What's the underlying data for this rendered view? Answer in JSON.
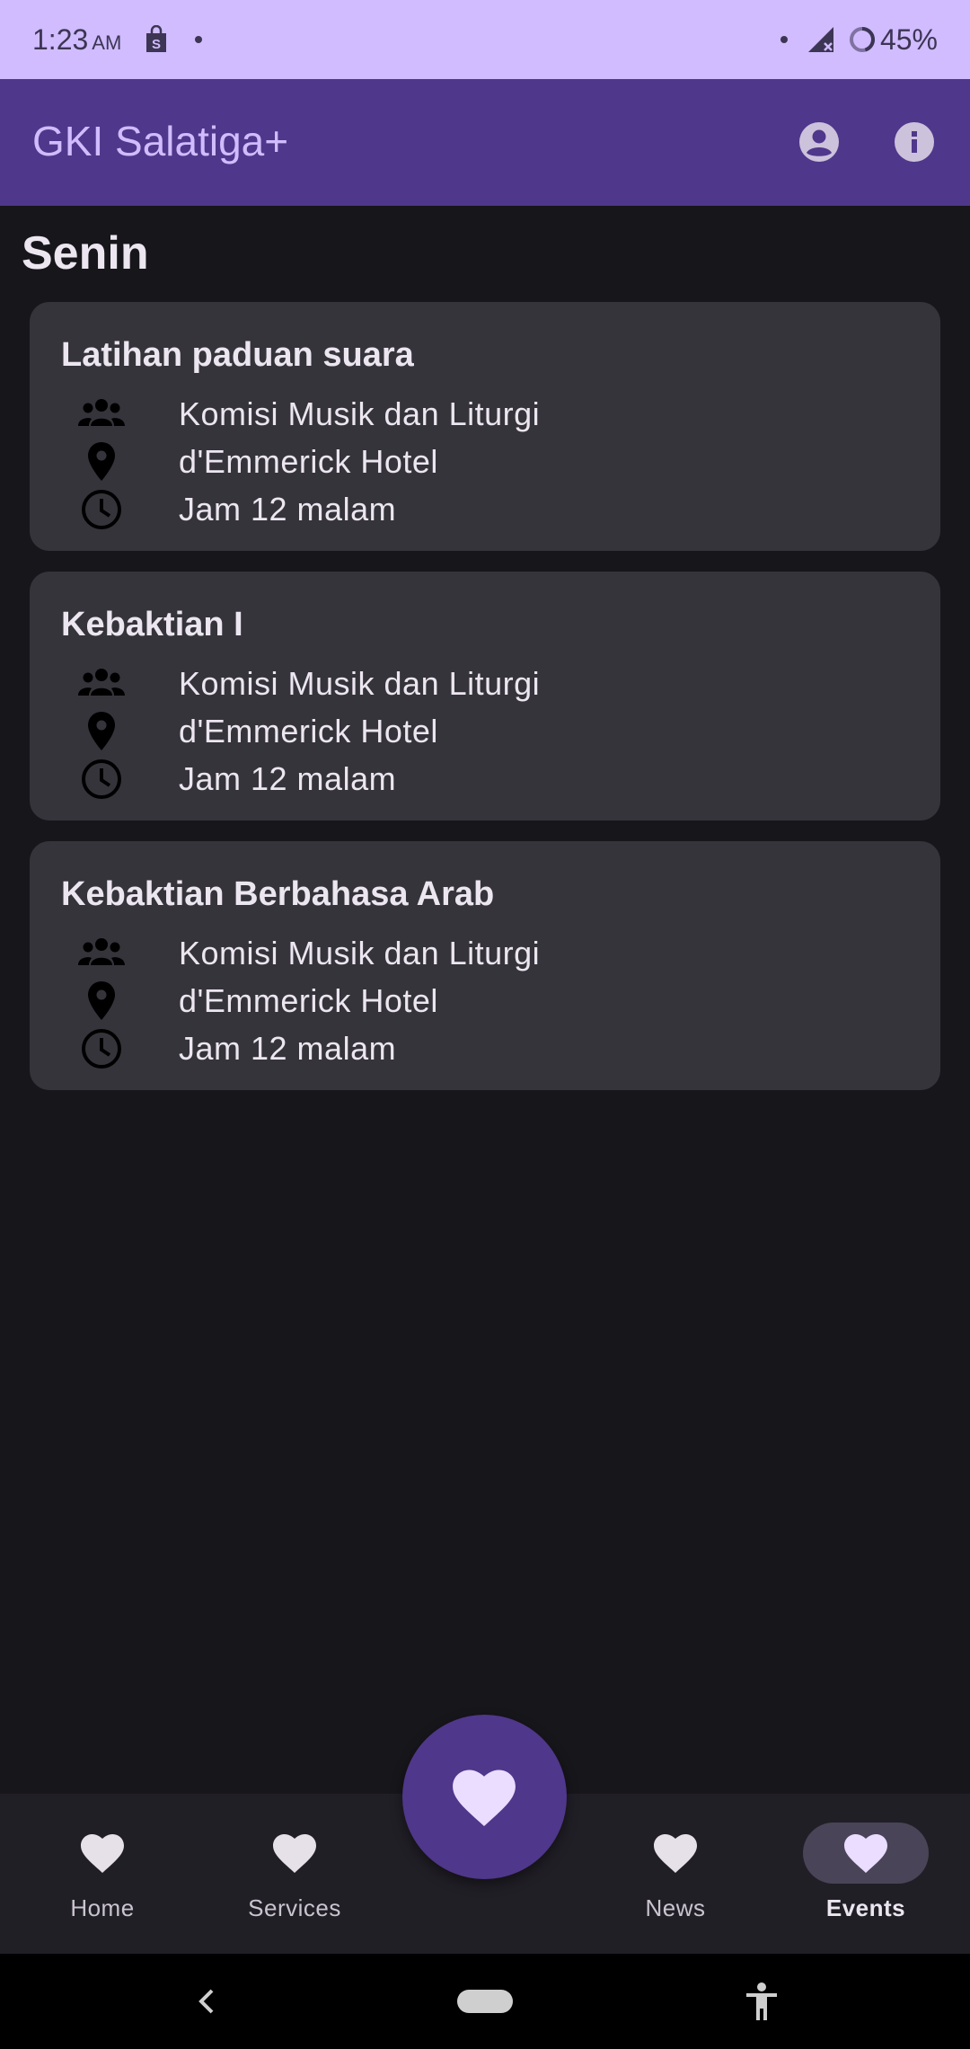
{
  "status_bar": {
    "time": "1:23",
    "ampm": "AM",
    "battery": "45%",
    "icons": [
      "shopping-bag-icon",
      "dot-icon",
      "dot-icon",
      "no-signal-icon",
      "battery-ring-icon"
    ]
  },
  "app_bar": {
    "title": "GKI Salatiga+",
    "actions": [
      "account-circle-icon",
      "info-icon"
    ]
  },
  "day": "Senin",
  "events": [
    {
      "title": "Latihan paduan suara",
      "group": "Komisi Musik dan Liturgi",
      "location": "d'Emmerick Hotel",
      "time": "Jam 12 malam"
    },
    {
      "title": "Kebaktian I",
      "group": "Komisi Musik dan Liturgi",
      "location": "d'Emmerick Hotel",
      "time": "Jam 12 malam"
    },
    {
      "title": "Kebaktian Berbahasa Arab",
      "group": "Komisi Musik dan Liturgi",
      "location": "d'Emmerick Hotel",
      "time": "Jam 12 malam"
    }
  ],
  "nav": {
    "items": [
      {
        "label": "Home",
        "icon": "heart-icon",
        "active": false
      },
      {
        "label": "Services",
        "icon": "heart-icon",
        "active": false
      },
      {
        "label": "News",
        "icon": "heart-icon",
        "active": false
      },
      {
        "label": "Events",
        "icon": "heart-icon",
        "active": true
      }
    ],
    "fab_icon": "heart-icon"
  },
  "colors": {
    "status_bar": "#d0bcff",
    "app_bar": "#4f378b",
    "background": "#17161b",
    "card": "#36343b",
    "nav_bar": "#211f26",
    "active_pill": "#4a4458"
  }
}
